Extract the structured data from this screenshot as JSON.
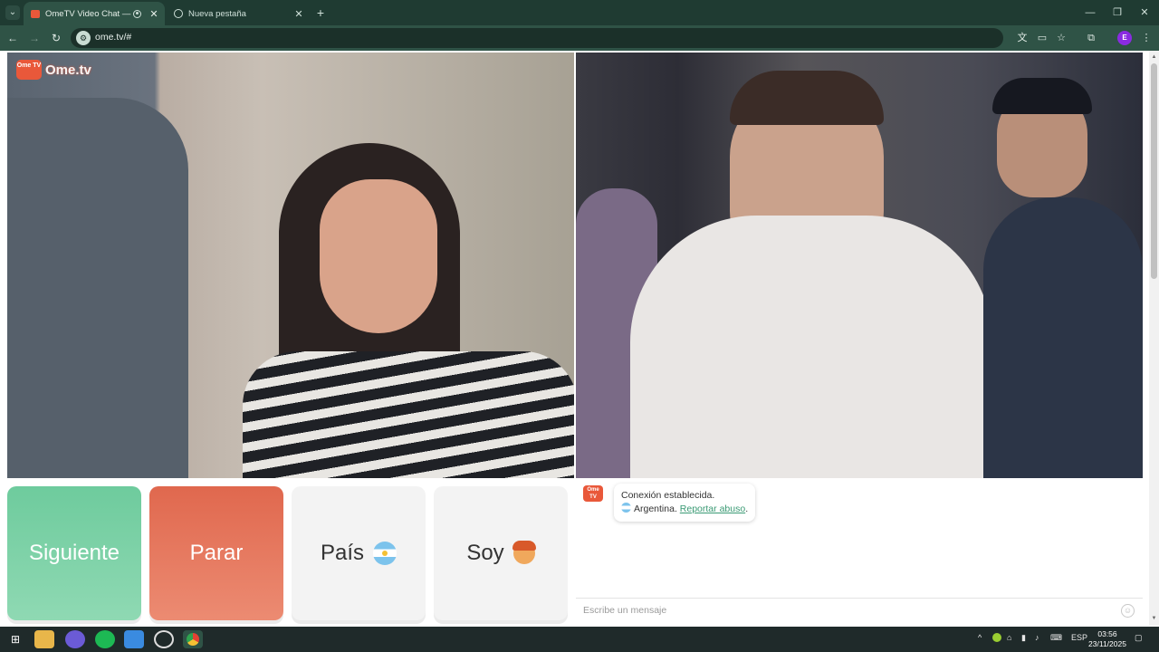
{
  "browser": {
    "tabs": [
      {
        "title": "OmeTV Video Chat — Ome",
        "active": true
      },
      {
        "title": "Nueva pestaña",
        "active": false
      }
    ],
    "new_tab_symbol": "+",
    "url": "ome.tv/#",
    "profile_initial": "E"
  },
  "site": {
    "logo_text": "Ome.tv",
    "logo_badge": "Ome TV"
  },
  "controls": {
    "next_label": "Siguiente",
    "stop_label": "Parar",
    "country_label": "País",
    "gender_label": "Soy"
  },
  "chat": {
    "status_message": "Conexión establecida.",
    "country": "Argentina.",
    "report_link": "Reportar abuso",
    "report_suffix": ".",
    "input_placeholder": "Escribe un mensaje"
  },
  "taskbar": {
    "language": "ESP",
    "time": "03:56",
    "date": "23/11/2025"
  },
  "colors": {
    "next_green": "#7ccfa5",
    "stop_red": "#e5755b",
    "brand_orange": "#e9583a",
    "browser_frame": "#1f3b32",
    "link_green": "#3a9a74"
  },
  "icons": [
    "tab-search-icon",
    "ometv-favicon-icon",
    "recording-icon",
    "close-icon",
    "globe-icon",
    "plus-icon",
    "minimize-icon",
    "restore-icon",
    "back-icon",
    "forward-icon",
    "reload-icon",
    "site-info-icon",
    "translate-icon",
    "cast-icon",
    "star-icon",
    "extensions-icon",
    "kebab-menu-icon",
    "argentina-flag-icon",
    "boy-emoji-icon",
    "smiley-icon",
    "windows-start-icon",
    "file-explorer-icon",
    "spotify-icon",
    "chrome-icon"
  ]
}
